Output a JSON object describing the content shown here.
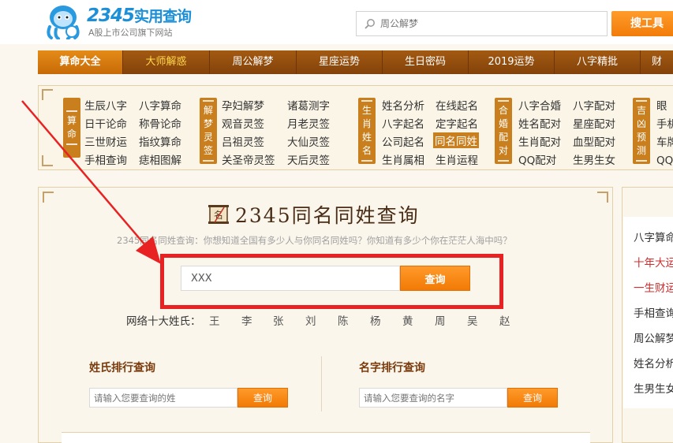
{
  "header": {
    "logo_num": "2345",
    "logo_cn": "实用查询",
    "slogan": "A股上市公司旗下网站",
    "search_placeholder": "周公解梦",
    "search_button": "搜工具"
  },
  "nav": [
    {
      "label": "算命大全",
      "active": true
    },
    {
      "label": "大师解惑",
      "highlight": true
    },
    {
      "label": "周公解梦"
    },
    {
      "label": "星座运势"
    },
    {
      "label": "生日密码"
    },
    {
      "label": "2019运势"
    },
    {
      "label": "八字精批"
    },
    {
      "label": "财"
    }
  ],
  "categories": {
    "groups": [
      {
        "label": [
          "算",
          "命"
        ],
        "links": [
          "生辰八字",
          "八字算命",
          "日干论命",
          "称骨论命",
          "三世财运",
          "指纹算命",
          "手相查询",
          "痣相图解"
        ]
      },
      {
        "label": [
          "解",
          "梦",
          "灵",
          "签"
        ],
        "links": [
          "孕妇解梦",
          "诸葛测字",
          "观音灵签",
          "月老灵签",
          "吕祖灵签",
          "大仙灵签",
          "关圣帝灵签",
          "天后灵签"
        ]
      },
      {
        "label": [
          "生",
          "肖",
          "姓",
          "名"
        ],
        "links": [
          "姓名分析",
          "在线起名",
          "八字起名",
          "定字起名",
          "公司起名",
          "同名同姓",
          "生肖属相",
          "生肖运程"
        ],
        "selected": "同名同姓"
      },
      {
        "label": [
          "合",
          "婚",
          "配",
          "对"
        ],
        "links": [
          "八字合婚",
          "八字配对",
          "姓名配对",
          "星座配对",
          "生肖配对",
          "血型配对",
          "QQ配对",
          "生男生女"
        ]
      },
      {
        "label": [
          "吉",
          "凶",
          "预",
          "测"
        ],
        "links": [
          "眼",
          "手机",
          "车牌",
          "QQ号"
        ]
      }
    ]
  },
  "main": {
    "title": "2345同名同姓查询",
    "desc": "2345同名同姓查询：你想知道全国有多少人与你同名同姓吗？你知道有多少个你在茫茫人海中吗？",
    "name_input_value": "XXX",
    "query_button": "查询",
    "top_surnames_label": "网络十大姓氏：",
    "top_surnames": [
      "王",
      "李",
      "张",
      "刘",
      "陈",
      "杨",
      "黄",
      "周",
      "吴",
      "赵"
    ],
    "surname_rank": {
      "title": "姓氏排行查询",
      "placeholder": "请输入您要查询的姓",
      "button": "查询"
    },
    "name_rank": {
      "title": "名字排行查询",
      "placeholder": "请输入您要查询的名字",
      "button": "查询"
    }
  },
  "side": {
    "links": [
      {
        "label": "八字算命",
        "red": false
      },
      {
        "label": "十年大运",
        "red": true
      },
      {
        "label": "一生财运",
        "red": true
      },
      {
        "label": "手相查询",
        "red": false
      },
      {
        "label": "周公解梦",
        "red": false
      },
      {
        "label": "姓名分析",
        "red": false
      },
      {
        "label": "生男生女",
        "red": false
      }
    ]
  },
  "colors": {
    "nav_bg": "#8f4a0c",
    "accent_orange": "#f27a05",
    "annotation_red": "#e82222",
    "category_label": "#c97f1d"
  }
}
